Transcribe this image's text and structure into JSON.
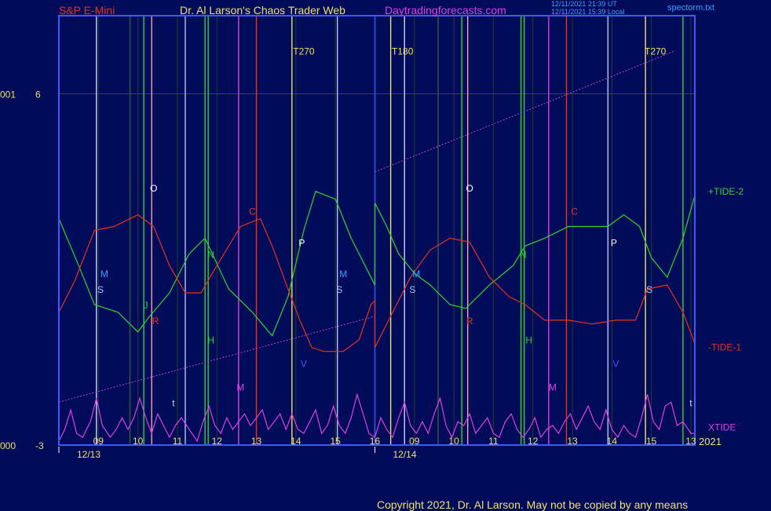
{
  "header": {
    "symbol": "S&P E-Mini",
    "title": "Dr. Al Larson's Chaos Trader Web",
    "site": "Daytradingforecasts.com",
    "stamp1": "12/11/2021 21:39 UT",
    "stamp2": "12/11/2021 15:39 Local",
    "file": "spectorm.txt"
  },
  "footer": {
    "copyright": "Copyright 2021, Dr. Al Larson. May not be copied by any means",
    "year": "2021"
  },
  "colors": {
    "background": "#000c5a",
    "frame": "#3a5cff",
    "tide_up": "#32d232",
    "tide_down": "#e8321e",
    "xtide": "#e040e0",
    "channel": "#c040d8",
    "label_yellow": "#f0e06a"
  },
  "chart_data": {
    "type": "line",
    "x_unit": "hour (12/13 08:00 to 12/14 13:00)",
    "ylim": [
      -3,
      6
    ],
    "y_axis_left": [
      {
        "value": 6,
        "label": "6",
        "prefix": "001"
      },
      {
        "value": -3,
        "label": "-3",
        "prefix": "000"
      }
    ],
    "x_tick_labels": [
      {
        "x": 9,
        "label": "09"
      },
      {
        "x": 10,
        "label": "10"
      },
      {
        "x": 11,
        "label": "11"
      },
      {
        "x": 12,
        "label": "12"
      },
      {
        "x": 13,
        "label": "13"
      },
      {
        "x": 14,
        "label": "14"
      },
      {
        "x": 15,
        "label": "15"
      },
      {
        "x": 16,
        "label": "16"
      },
      {
        "x": 17,
        "label": "09"
      },
      {
        "x": 18,
        "label": "10"
      },
      {
        "x": 19,
        "label": "11"
      },
      {
        "x": 20,
        "label": "12"
      },
      {
        "x": 21,
        "label": "13"
      },
      {
        "x": 22,
        "label": "14"
      },
      {
        "x": 23,
        "label": "15"
      },
      {
        "x": 24,
        "label": "13"
      }
    ],
    "date_labels": [
      {
        "x": 8.0,
        "label": "12/13"
      },
      {
        "x": 16.0,
        "label": "12/14"
      }
    ],
    "series": [
      {
        "name": "+TIDE-2",
        "color": "#32d232",
        "points": [
          [
            8.0,
            2.8
          ],
          [
            8.5,
            1.6
          ],
          [
            8.9,
            0.6
          ],
          [
            9.5,
            0.4
          ],
          [
            10.0,
            -0.1
          ],
          [
            10.3,
            0.3
          ],
          [
            10.8,
            0.9
          ],
          [
            11.3,
            1.9
          ],
          [
            11.7,
            2.3
          ],
          [
            12.3,
            1.0
          ],
          [
            12.9,
            0.4
          ],
          [
            13.4,
            -0.2
          ],
          [
            13.8,
            0.8
          ],
          [
            14.2,
            2.5
          ],
          [
            14.5,
            3.5
          ],
          [
            15.0,
            3.3
          ],
          [
            15.4,
            2.3
          ],
          [
            15.8,
            1.5
          ],
          [
            16.0,
            1.1
          ],
          [
            16.0,
            3.2
          ],
          [
            16.3,
            2.6
          ],
          [
            16.6,
            1.9
          ],
          [
            17.0,
            1.4
          ],
          [
            17.4,
            1.1
          ],
          [
            17.9,
            0.6
          ],
          [
            18.3,
            0.5
          ],
          [
            18.9,
            1.1
          ],
          [
            19.5,
            1.6
          ],
          [
            19.8,
            2.1
          ],
          [
            20.3,
            2.3
          ],
          [
            20.9,
            2.6
          ],
          [
            21.4,
            2.6
          ],
          [
            21.9,
            2.6
          ],
          [
            22.3,
            2.9
          ],
          [
            22.7,
            2.6
          ],
          [
            23.0,
            1.8
          ],
          [
            23.4,
            1.3
          ],
          [
            23.8,
            2.3
          ],
          [
            24.1,
            3.4
          ]
        ]
      },
      {
        "name": "-TIDE-1",
        "color": "#e8321e",
        "points": [
          [
            8.0,
            0.4
          ],
          [
            8.4,
            1.2
          ],
          [
            8.9,
            2.5
          ],
          [
            9.4,
            2.6
          ],
          [
            10.0,
            2.9
          ],
          [
            10.4,
            2.6
          ],
          [
            10.8,
            1.6
          ],
          [
            11.2,
            0.9
          ],
          [
            11.6,
            0.9
          ],
          [
            12.0,
            1.6
          ],
          [
            12.6,
            2.6
          ],
          [
            13.1,
            2.8
          ],
          [
            13.4,
            2.1
          ],
          [
            13.8,
            1.0
          ],
          [
            14.1,
            0.2
          ],
          [
            14.4,
            -0.5
          ],
          [
            14.7,
            -0.6
          ],
          [
            15.2,
            -0.6
          ],
          [
            15.6,
            -0.3
          ],
          [
            15.9,
            0.6
          ],
          [
            16.0,
            0.7
          ],
          [
            16.0,
            -0.5
          ],
          [
            16.4,
            0.3
          ],
          [
            16.9,
            1.3
          ],
          [
            17.4,
            2.0
          ],
          [
            17.9,
            2.3
          ],
          [
            18.4,
            2.2
          ],
          [
            18.9,
            1.3
          ],
          [
            19.4,
            0.8
          ],
          [
            19.8,
            0.6
          ],
          [
            20.3,
            0.2
          ],
          [
            20.9,
            0.2
          ],
          [
            21.5,
            0.1
          ],
          [
            22.1,
            0.2
          ],
          [
            22.6,
            0.2
          ],
          [
            22.9,
            1.0
          ],
          [
            23.4,
            1.1
          ],
          [
            23.8,
            0.4
          ],
          [
            24.1,
            -0.4
          ]
        ]
      },
      {
        "name": "XTIDE",
        "color": "#e040e0",
        "points": [
          [
            8.0,
            -2.9
          ],
          [
            8.15,
            -2.6
          ],
          [
            8.3,
            -2.1
          ],
          [
            8.45,
            -2.7
          ],
          [
            8.6,
            -2.8
          ],
          [
            8.8,
            -2.4
          ],
          [
            8.95,
            -1.8
          ],
          [
            9.1,
            -2.5
          ],
          [
            9.3,
            -2.8
          ],
          [
            9.45,
            -2.6
          ],
          [
            9.6,
            -2.3
          ],
          [
            9.75,
            -2.6
          ],
          [
            9.9,
            -2.3
          ],
          [
            10.05,
            -1.8
          ],
          [
            10.2,
            -2.3
          ],
          [
            10.35,
            -2.7
          ],
          [
            10.5,
            -2.2
          ],
          [
            10.65,
            -2.5
          ],
          [
            10.8,
            -2.8
          ],
          [
            10.95,
            -2.5
          ],
          [
            11.1,
            -2.3
          ],
          [
            11.3,
            -2.6
          ],
          [
            11.5,
            -2.9
          ],
          [
            11.65,
            -2.4
          ],
          [
            11.8,
            -2.0
          ],
          [
            11.95,
            -2.5
          ],
          [
            12.1,
            -2.7
          ],
          [
            12.25,
            -2.3
          ],
          [
            12.4,
            -2.6
          ],
          [
            12.55,
            -2.4
          ],
          [
            12.7,
            -2.2
          ],
          [
            12.85,
            -2.5
          ],
          [
            13.0,
            -2.3
          ],
          [
            13.15,
            -2.1
          ],
          [
            13.3,
            -2.6
          ],
          [
            13.45,
            -2.4
          ],
          [
            13.6,
            -2.2
          ],
          [
            13.75,
            -2.6
          ],
          [
            13.9,
            -2.2
          ],
          [
            14.05,
            -2.6
          ],
          [
            14.2,
            -2.7
          ],
          [
            14.35,
            -2.4
          ],
          [
            14.5,
            -2.1
          ],
          [
            14.65,
            -2.7
          ],
          [
            14.8,
            -2.5
          ],
          [
            14.95,
            -2.0
          ],
          [
            15.1,
            -2.5
          ],
          [
            15.25,
            -2.7
          ],
          [
            15.4,
            -2.3
          ],
          [
            15.55,
            -1.7
          ],
          [
            15.7,
            -2.2
          ],
          [
            15.85,
            -2.7
          ],
          [
            16.0,
            -2.8
          ],
          [
            16.15,
            -2.3
          ],
          [
            16.3,
            -2.6
          ],
          [
            16.45,
            -2.8
          ],
          [
            16.6,
            -2.3
          ],
          [
            16.75,
            -1.9
          ],
          [
            16.9,
            -2.5
          ],
          [
            17.05,
            -2.7
          ],
          [
            17.2,
            -2.4
          ],
          [
            17.35,
            -2.7
          ],
          [
            17.5,
            -2.2
          ],
          [
            17.65,
            -1.8
          ],
          [
            17.8,
            -2.5
          ],
          [
            17.95,
            -2.8
          ],
          [
            18.1,
            -2.4
          ],
          [
            18.25,
            -2.5
          ],
          [
            18.4,
            -2.2
          ],
          [
            18.55,
            -2.7
          ],
          [
            18.7,
            -2.5
          ],
          [
            18.85,
            -2.3
          ],
          [
            19.0,
            -2.7
          ],
          [
            19.15,
            -2.8
          ],
          [
            19.3,
            -2.4
          ],
          [
            19.45,
            -2.2
          ],
          [
            19.6,
            -2.6
          ],
          [
            19.75,
            -2.8
          ],
          [
            19.9,
            -2.6
          ],
          [
            20.05,
            -2.3
          ],
          [
            20.2,
            -2.8
          ],
          [
            20.35,
            -2.6
          ],
          [
            20.5,
            -2.5
          ],
          [
            20.65,
            -2.7
          ],
          [
            20.8,
            -2.4
          ],
          [
            20.95,
            -2.2
          ],
          [
            21.1,
            -2.6
          ],
          [
            21.25,
            -2.3
          ],
          [
            21.4,
            -2.0
          ],
          [
            21.55,
            -2.4
          ],
          [
            21.7,
            -2.6
          ],
          [
            21.85,
            -2.1
          ],
          [
            22.0,
            -2.6
          ],
          [
            22.15,
            -2.8
          ],
          [
            22.3,
            -2.5
          ],
          [
            22.45,
            -2.7
          ],
          [
            22.6,
            -2.8
          ],
          [
            22.75,
            -2.3
          ],
          [
            22.9,
            -1.7
          ],
          [
            23.05,
            -2.4
          ],
          [
            23.2,
            -2.6
          ],
          [
            23.35,
            -2.0
          ],
          [
            23.5,
            -1.9
          ],
          [
            23.65,
            -2.5
          ],
          [
            23.8,
            -2.4
          ],
          [
            24.0,
            -2.7
          ],
          [
            24.1,
            -2.7
          ]
        ]
      }
    ],
    "channel_lines": [
      {
        "color": "#c040d8",
        "points": [
          [
            8.0,
            -1.9
          ],
          [
            16.0,
            0.3
          ]
        ]
      },
      {
        "color": "#c040d8",
        "points": [
          [
            16.0,
            4.0
          ],
          [
            23.6,
            7.1
          ]
        ]
      }
    ],
    "vertical_lines": [
      {
        "x": 8.95,
        "color": "#c8d2ff"
      },
      {
        "x": 9.8,
        "color": "#3a5a3a"
      },
      {
        "x": 10.15,
        "color": "#32d232"
      },
      {
        "x": 10.35,
        "color": "#ffa0a0"
      },
      {
        "x": 11.2,
        "color": "#b0c4ff"
      },
      {
        "x": 11.7,
        "color": "#32d232"
      },
      {
        "x": 11.78,
        "color": "#32d232"
      },
      {
        "x": 12.55,
        "color": "#e040e0"
      },
      {
        "x": 13.0,
        "color": "#e8321e"
      },
      {
        "x": 13.9,
        "color": "#f0e06a"
      },
      {
        "x": 15.05,
        "color": "#b0c4ff"
      },
      {
        "x": 16.0,
        "color": "#3a5cff"
      },
      {
        "x": 16.4,
        "color": "#f0e06a"
      },
      {
        "x": 16.75,
        "color": "#c8d2ff"
      },
      {
        "x": 17.6,
        "color": "#3a5a3a"
      },
      {
        "x": 18.2,
        "color": "#32d232"
      },
      {
        "x": 18.35,
        "color": "#ffa0a0"
      },
      {
        "x": 19.7,
        "color": "#32d232"
      },
      {
        "x": 19.78,
        "color": "#32d232"
      },
      {
        "x": 20.4,
        "color": "#e040e0"
      },
      {
        "x": 20.85,
        "color": "#e8321e"
      },
      {
        "x": 21.9,
        "color": "#b0c4ff"
      },
      {
        "x": 22.85,
        "color": "#f0e06a"
      },
      {
        "x": 23.8,
        "color": "#32d232"
      }
    ],
    "markers": [
      {
        "text": "T270",
        "x": 14.2,
        "y": 7.0,
        "color": "#f0e06a"
      },
      {
        "text": "T180",
        "x": 16.7,
        "y": 7.0,
        "color": "#f0e06a"
      },
      {
        "text": "T270",
        "x": 23.1,
        "y": 7.0,
        "color": "#f0e06a"
      },
      {
        "text": "O",
        "x": 10.4,
        "y": 3.5,
        "color": "#ffffff"
      },
      {
        "text": "O",
        "x": 18.4,
        "y": 3.5,
        "color": "#ffffff"
      },
      {
        "text": "C",
        "x": 12.9,
        "y": 2.9,
        "color": "#e8321e"
      },
      {
        "text": "C",
        "x": 21.05,
        "y": 2.9,
        "color": "#e8321e"
      },
      {
        "text": "P",
        "x": 14.15,
        "y": 2.1,
        "color": "#ffffff"
      },
      {
        "text": "P",
        "x": 22.05,
        "y": 2.1,
        "color": "#ffffff"
      },
      {
        "text": "N",
        "x": 11.85,
        "y": 1.8,
        "color": "#32d232"
      },
      {
        "text": "N",
        "x": 19.75,
        "y": 1.8,
        "color": "#32d232"
      },
      {
        "text": "M",
        "x": 9.15,
        "y": 1.3,
        "color": "#3aa0ff"
      },
      {
        "text": "M",
        "x": 15.2,
        "y": 1.3,
        "color": "#3aa0ff"
      },
      {
        "text": "M",
        "x": 17.05,
        "y": 1.3,
        "color": "#3aa0ff"
      },
      {
        "text": "S",
        "x": 9.05,
        "y": 0.9,
        "color": "#b0c4ff"
      },
      {
        "text": "S",
        "x": 15.1,
        "y": 0.9,
        "color": "#b0c4ff"
      },
      {
        "text": "S",
        "x": 16.95,
        "y": 0.9,
        "color": "#b0c4ff"
      },
      {
        "text": "S",
        "x": 22.95,
        "y": 0.9,
        "color": "#b0c4ff"
      },
      {
        "text": "J",
        "x": 10.2,
        "y": 0.5,
        "color": "#32d232"
      },
      {
        "text": "R",
        "x": 10.45,
        "y": 0.1,
        "color": "#e8321e"
      },
      {
        "text": "R",
        "x": 18.4,
        "y": 0.1,
        "color": "#e8321e"
      },
      {
        "text": "H",
        "x": 11.85,
        "y": -0.4,
        "color": "#32d232"
      },
      {
        "text": "H",
        "x": 19.9,
        "y": -0.4,
        "color": "#32d232"
      },
      {
        "text": "V",
        "x": 14.2,
        "y": -1.0,
        "color": "#3a5cff"
      },
      {
        "text": "V",
        "x": 22.1,
        "y": -1.0,
        "color": "#3a5cff"
      },
      {
        "text": "M",
        "x": 12.6,
        "y": -1.6,
        "color": "#e040e0"
      },
      {
        "text": "M",
        "x": 20.5,
        "y": -1.6,
        "color": "#e040e0"
      },
      {
        "text": "t",
        "x": 10.9,
        "y": -2.0,
        "color": "#c8d2ff"
      },
      {
        "text": "t",
        "x": 24.0,
        "y": -2.0,
        "color": "#c8d2ff"
      }
    ],
    "series_labels": [
      {
        "text": "+TIDE-2",
        "y": 3.5,
        "color": "#32d232"
      },
      {
        "text": "-TIDE-1",
        "y": -0.5,
        "color": "#e8321e"
      },
      {
        "text": "XTIDE",
        "y": -2.55,
        "color": "#e040e0"
      }
    ]
  }
}
